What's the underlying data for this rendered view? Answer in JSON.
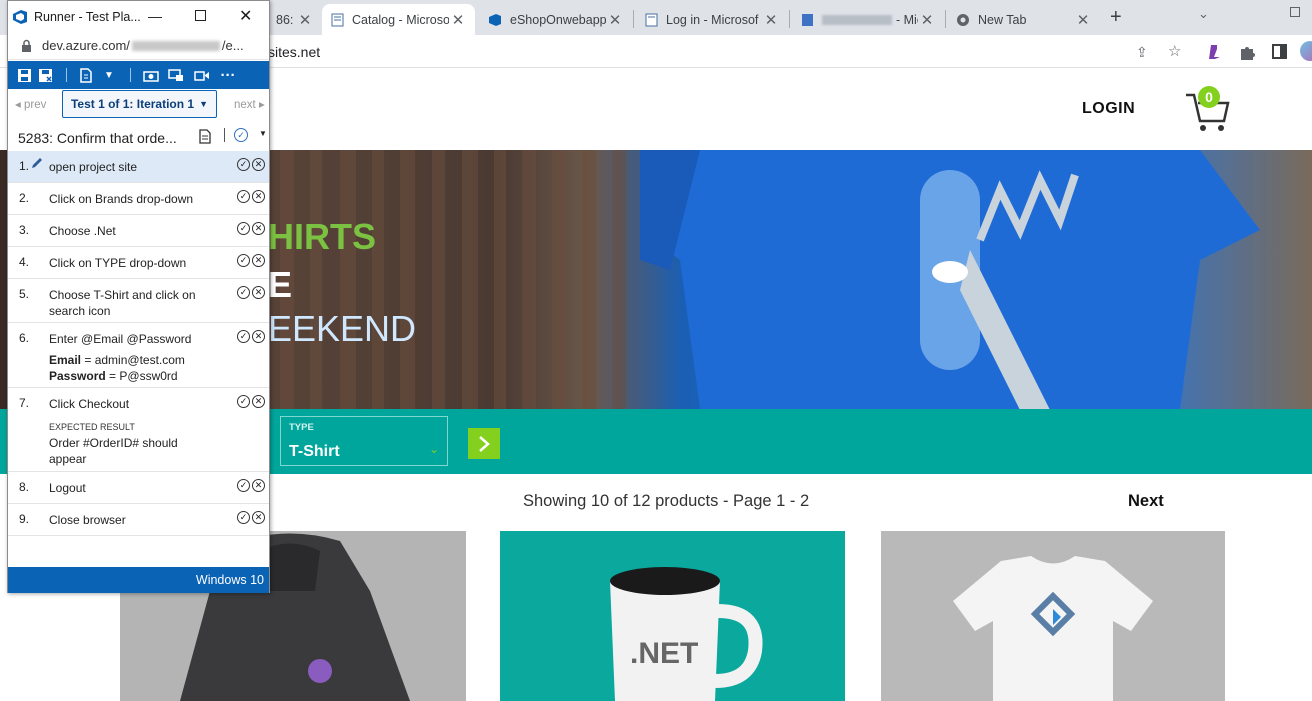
{
  "browser": {
    "tabs": [
      {
        "label": "86:",
        "active": false
      },
      {
        "label": "Catalog - Microso",
        "active": true
      },
      {
        "label": "eShopOnwebapp",
        "active": false
      },
      {
        "label": "Log in - Microsof",
        "active": false
      },
      {
        "label": "- Mic",
        "active": false
      },
      {
        "label": "New Tab",
        "active": false
      }
    ],
    "address": "sites.net"
  },
  "shop": {
    "login": "LOGIN",
    "cart_count": "0",
    "hero_line1": "HIRTS",
    "hero_line2": "E",
    "hero_line3": "EEKEND",
    "type_label": "TYPE",
    "type_value": "T-Shirt",
    "showing": "Showing 10 of 12 products - Page 1 - 2",
    "next": "Next",
    "left_fragment": "s",
    "mug_text": ".NET"
  },
  "runner": {
    "title": "Runner - Test Pla...",
    "url": "dev.azure.com/",
    "url_tail": "/e...",
    "prev": "prev",
    "iteration": "Test 1 of 1: Iteration 1",
    "next": "next",
    "test_case": "5283: Confirm that orde...",
    "steps": [
      {
        "num": "1.",
        "text": "open project site"
      },
      {
        "num": "2.",
        "text": "Click on Brands drop-down"
      },
      {
        "num": "3.",
        "text": "Choose .Net"
      },
      {
        "num": "4.",
        "text": "Click on TYPE drop-down"
      },
      {
        "num": "5.",
        "text": "Choose T-Shirt and click on search icon"
      },
      {
        "num": "6.",
        "text": "Enter @Email @Password",
        "email_label": "Email",
        "email_value": "= admin@test.com",
        "password_label": "Password",
        "password_value": "= P@ssw0rd"
      },
      {
        "num": "7.",
        "text": "Click Checkout",
        "expected_label": "EXPECTED RESULT",
        "expected_text": "Order #OrderID# should appear"
      },
      {
        "num": "8.",
        "text": "Logout"
      },
      {
        "num": "9.",
        "text": "Close browser"
      }
    ],
    "status": "Windows 10"
  },
  "colors": {
    "azure_blue": "#0b63b5",
    "teal": "#00a69c",
    "lime": "#83d01e",
    "hero_green": "#7cc242"
  }
}
